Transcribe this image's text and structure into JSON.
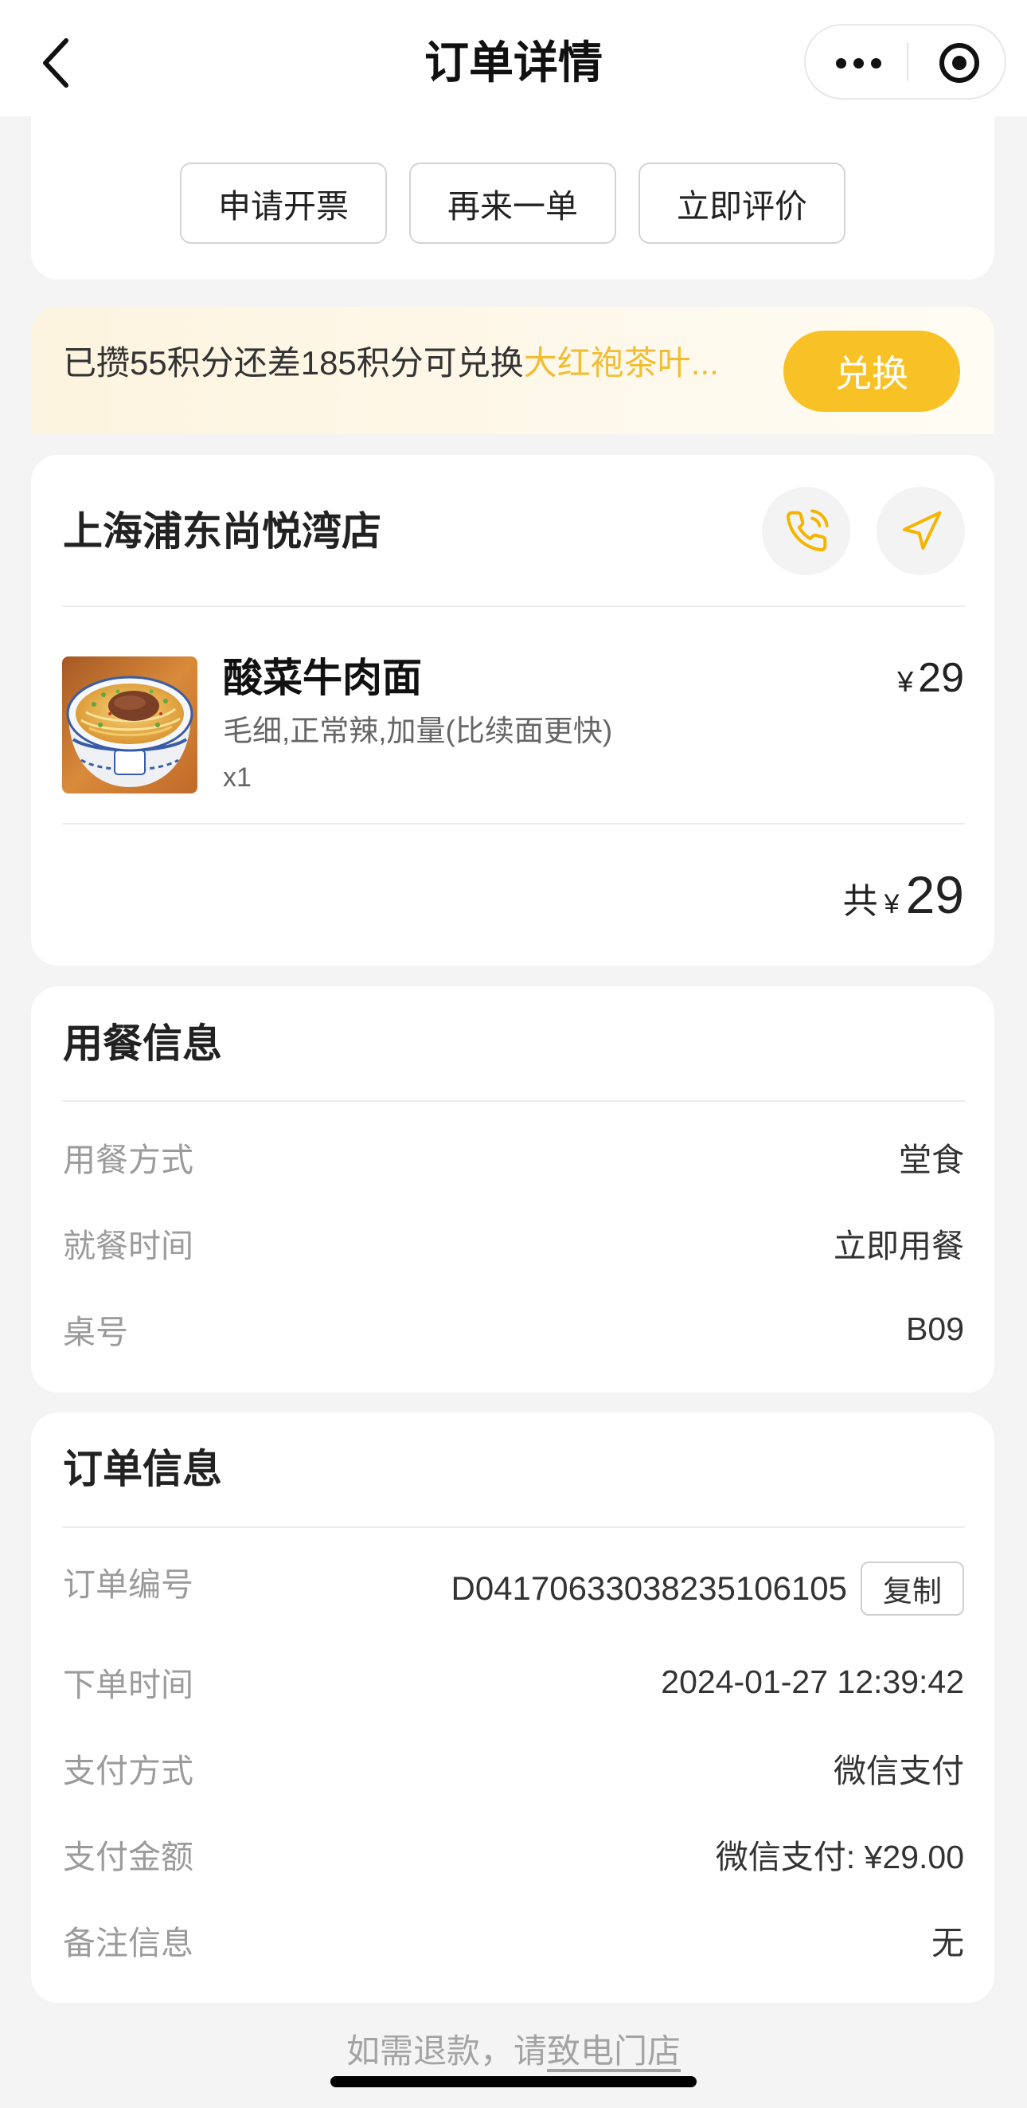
{
  "header": {
    "title": "订单详情"
  },
  "actions": {
    "invoice": "申请开票",
    "reorder": "再来一单",
    "review": "立即评价"
  },
  "points_banner": {
    "text": "已攒55积分还差185积分可兑换",
    "reward": "大红袍茶叶...",
    "button": "兑换"
  },
  "store": {
    "name": "上海浦东尚悦湾店"
  },
  "item": {
    "name": "酸菜牛肉面",
    "currency": "¥",
    "price": "29",
    "specs": "毛细,正常辣,加量(比续面更快)",
    "quantity": "x1"
  },
  "total": {
    "label": "共",
    "currency": "¥",
    "amount": "29"
  },
  "dining_info": {
    "title": "用餐信息",
    "rows": [
      {
        "label": "用餐方式",
        "value": "堂食"
      },
      {
        "label": "就餐时间",
        "value": "立即用餐"
      },
      {
        "label": "桌号",
        "value": "B09"
      }
    ]
  },
  "order_info": {
    "title": "订单信息",
    "copy_label": "复制",
    "rows": [
      {
        "label": "订单编号",
        "value": "D04170633038235106105"
      },
      {
        "label": "下单时间",
        "value": "2024-01-27 12:39:42"
      },
      {
        "label": "支付方式",
        "value": "微信支付"
      },
      {
        "label": "支付金额",
        "value": "微信支付: ¥29.00"
      },
      {
        "label": "备注信息",
        "value": "无"
      }
    ]
  },
  "footer": {
    "prefix": "如需退款，请",
    "link": "致电门店"
  },
  "icons": {
    "back": "back-arrow-icon",
    "more": "more-dots-icon",
    "close": "target-icon",
    "call": "phone-icon",
    "navigate": "navigation-icon"
  },
  "colors": {
    "accent": "#f8c227",
    "accent_text": "#f2bd33",
    "icon": "#f5b400",
    "label": "#9b9b9b",
    "text": "#222222",
    "background": "#f4f4f4"
  }
}
